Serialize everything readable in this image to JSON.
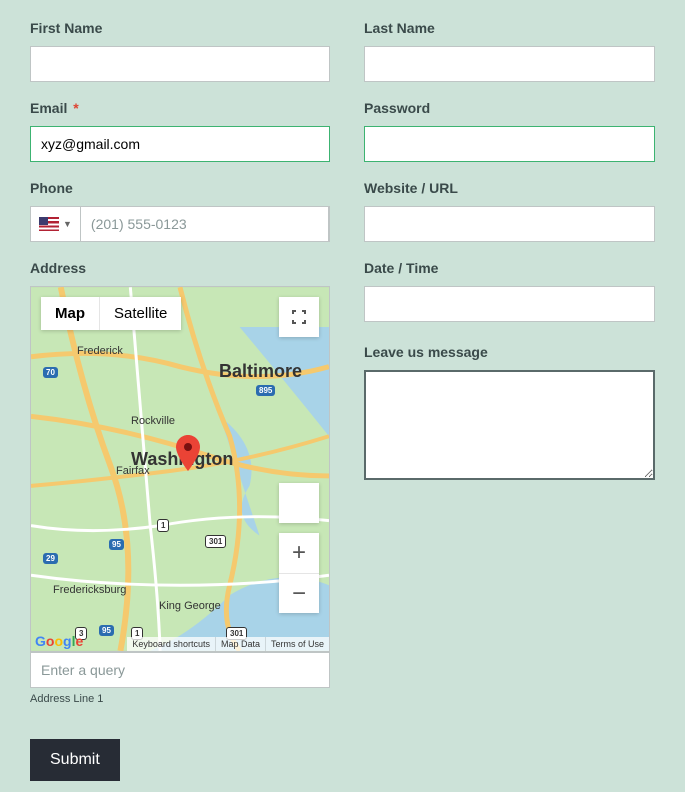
{
  "fields": {
    "first_name": {
      "label": "First Name",
      "value": ""
    },
    "last_name": {
      "label": "Last Name",
      "value": ""
    },
    "email": {
      "label": "Email",
      "required": "*",
      "value": "xyz@gmail.com"
    },
    "password": {
      "label": "Password",
      "value": ""
    },
    "phone": {
      "label": "Phone",
      "placeholder": "(201) 555-0123"
    },
    "website": {
      "label": "Website / URL",
      "value": ""
    },
    "address": {
      "label": "Address",
      "line1_label": "Address Line 1",
      "search_placeholder": "Enter a query"
    },
    "datetime": {
      "label": "Date / Time",
      "value": ""
    },
    "message": {
      "label": "Leave us message",
      "value": ""
    }
  },
  "map": {
    "type_map": "Map",
    "type_sat": "Satellite",
    "zoom_in": "+",
    "zoom_out": "−",
    "attrib": {
      "shortcuts": "Keyboard shortcuts",
      "data": "Map Data",
      "terms": "Terms of Use"
    },
    "logo": "Google",
    "cities": {
      "baltimore": "Baltimore",
      "washington": "Washington",
      "frederick": "Frederick",
      "rockville": "Rockville",
      "fairfax": "Fairfax",
      "fredericksburg": "Fredericksburg",
      "king_george": "King George"
    },
    "routes": {
      "i70": "70",
      "i895": "895",
      "i95a": "95",
      "i95b": "95",
      "us1a": "1",
      "us1b": "1",
      "us301a": "301",
      "us301b": "301",
      "va3": "3",
      "us29": "29"
    }
  },
  "submit": "Submit"
}
